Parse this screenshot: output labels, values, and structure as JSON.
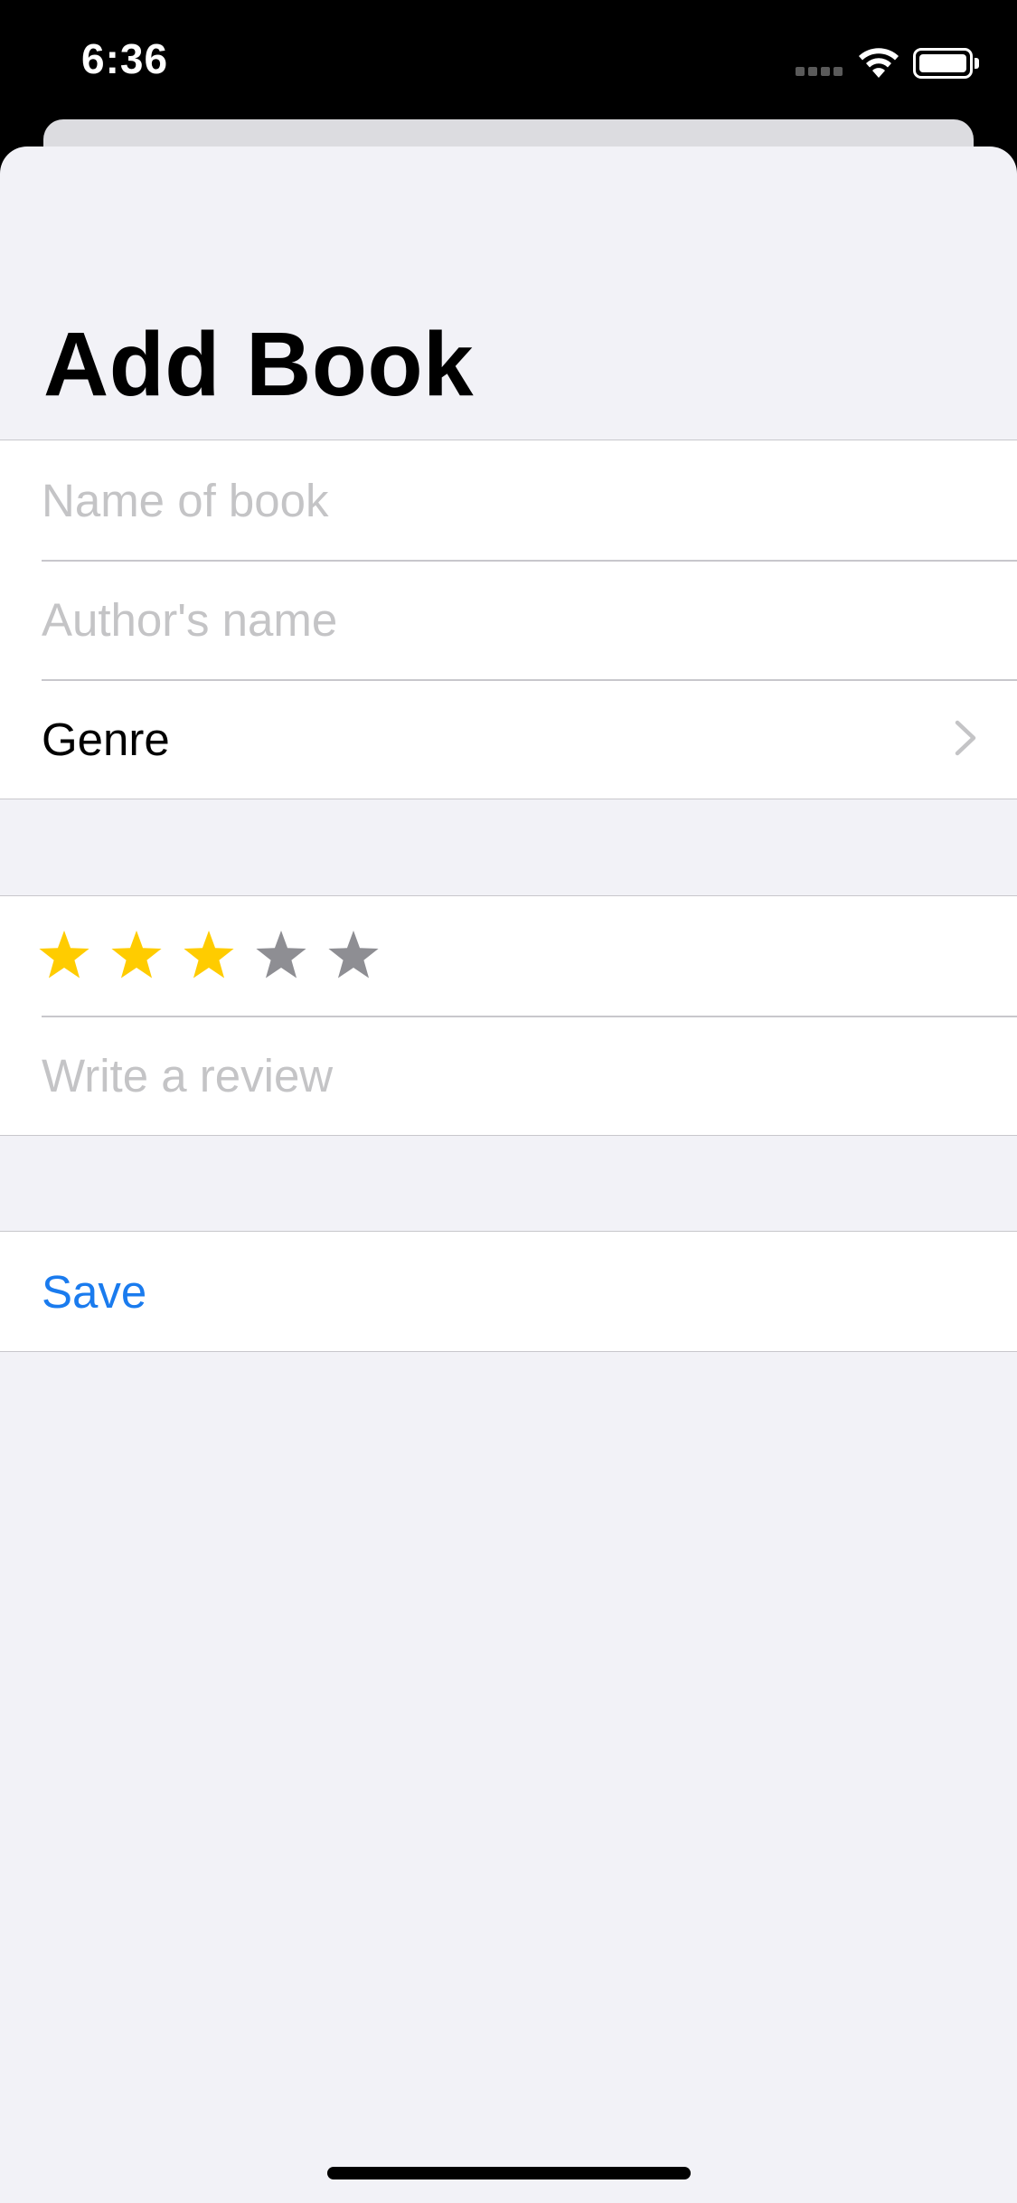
{
  "status_bar": {
    "time": "6:36",
    "signal_icon": "cellular-signal-icon",
    "wifi_icon": "wifi-icon",
    "battery_icon": "battery-icon"
  },
  "page": {
    "title": "Add Book"
  },
  "book_section": {
    "name_field": {
      "value": "",
      "placeholder": "Name of book"
    },
    "author_field": {
      "value": "",
      "placeholder": "Author's name"
    },
    "genre": {
      "label": "Genre",
      "icon": "chevron-right-icon"
    }
  },
  "review_section": {
    "rating": {
      "value": 3,
      "max": 5,
      "icon": "star-icon"
    },
    "review_field": {
      "value": "",
      "placeholder": "Write a review"
    }
  },
  "save_section": {
    "save_label": "Save"
  },
  "colors": {
    "accent": "#1a7bee",
    "star_filled": "#ffcc00",
    "star_empty": "#8e8e93",
    "background": "#f2f2f7",
    "placeholder": "#c4c4c6"
  }
}
